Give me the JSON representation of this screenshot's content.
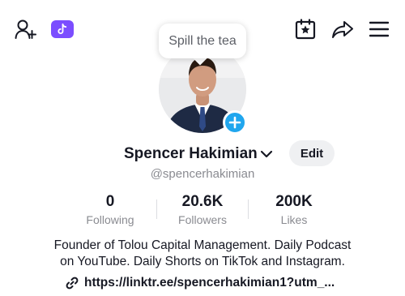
{
  "header": {
    "icons": [
      "add-friend-icon",
      "tiktok-studio-icon",
      "calendar-star-icon",
      "share-icon",
      "menu-icon"
    ]
  },
  "tooltip": {
    "text": "Spill the tea"
  },
  "profile": {
    "name": "Spencer Hakimian",
    "username": "@spencerhakimian",
    "edit_label": "Edit"
  },
  "stats": [
    {
      "value": "0",
      "label": "Following"
    },
    {
      "value": "20.6K",
      "label": "Followers"
    },
    {
      "value": "200K",
      "label": "Likes"
    }
  ],
  "bio": {
    "line1": "Founder of Tolou Capital Management. Daily Podcast",
    "line2": "on YouTube. Daily Shorts on TikTok and Instagram."
  },
  "link": {
    "text": "https://linktr.ee/spencerhakimian1?utm_..."
  },
  "colors": {
    "accent_blue": "#20a6ee",
    "studio_purple": "#7b4dff"
  }
}
